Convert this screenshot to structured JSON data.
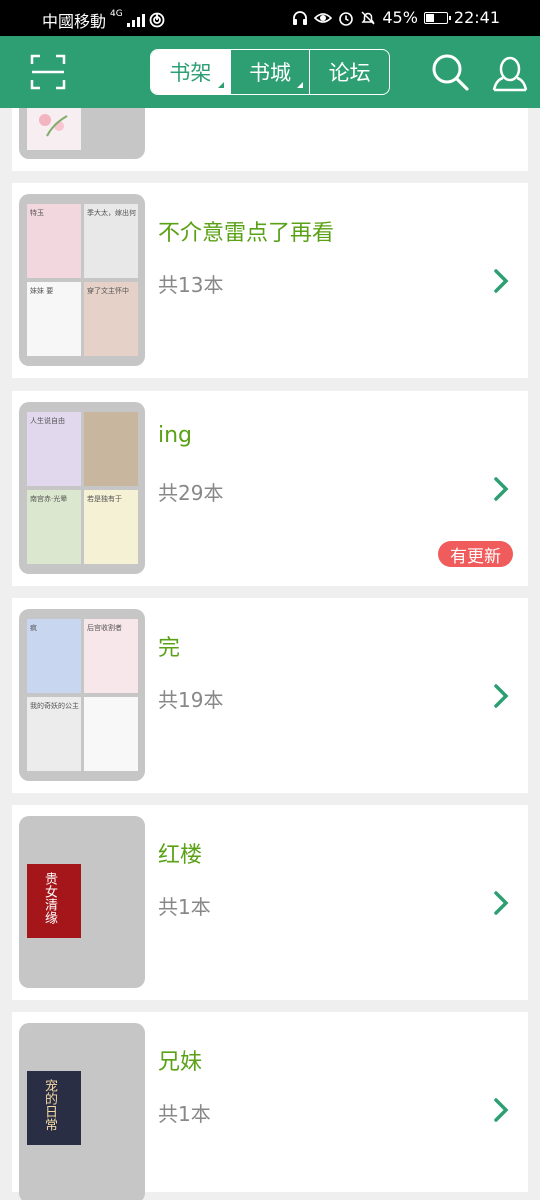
{
  "status_bar": {
    "carrier": "中國移動",
    "network": "4G",
    "battery": "45%",
    "battery_level": 0.45,
    "time": "22:41"
  },
  "header": {
    "tabs": [
      {
        "label": "书架",
        "active": true,
        "has_dropdown": true
      },
      {
        "label": "书城",
        "active": false,
        "has_dropdown": true
      },
      {
        "label": "论坛",
        "active": false,
        "has_dropdown": false
      }
    ],
    "icons": [
      "scan-icon",
      "search-icon",
      "user-icon"
    ],
    "colors": {
      "brand": "#2e9f72",
      "title_green": "#5ba117",
      "badge_red": "#f05b5b"
    }
  },
  "shelf_groups": [
    {
      "name": "不介意雷点了再看",
      "count": "共13本",
      "has_update": false,
      "covers": [
        {
          "title": "特玉",
          "color": "#f3d7de"
        },
        {
          "title": "季大太，嫁出何",
          "color": "#e8e8e8"
        },
        {
          "title": "妹妹 要",
          "color": "#f7f7f7"
        },
        {
          "title": "穿了文主怀中",
          "color": "#e5d1c8"
        }
      ]
    },
    {
      "name": "ing",
      "count": "共29本",
      "has_update": true,
      "badge": "有更新",
      "covers": [
        {
          "title": "人生说自由",
          "color": "#e1d8ee"
        },
        {
          "title": "",
          "color": "#c9b69e"
        },
        {
          "title": "南宫赤·光晕",
          "color": "#dbe8cf"
        },
        {
          "title": "若是独有于",
          "color": "#f4f1d4"
        }
      ]
    },
    {
      "name": "完",
      "count": "共19本",
      "has_update": false,
      "covers": [
        {
          "title": "疯",
          "color": "#c8d6ef"
        },
        {
          "title": "后宫收割者",
          "color": "#f7e6ea"
        },
        {
          "title": "我的奇妖的公主",
          "color": "#ececec"
        },
        {
          "title": "",
          "color": "#f8f8f8"
        }
      ]
    },
    {
      "name": "红楼",
      "count": "共1本",
      "has_update": false,
      "covers": [
        {
          "title": "贵女清缘",
          "color": "#a4161a"
        }
      ]
    },
    {
      "name": "兄妹",
      "count": "共1本",
      "has_update": false,
      "covers": [
        {
          "title": "宠的日常",
          "color": "#2a2e44"
        }
      ]
    }
  ]
}
